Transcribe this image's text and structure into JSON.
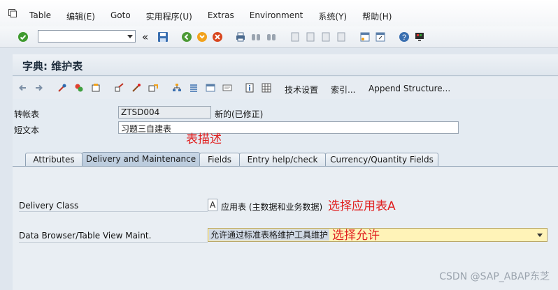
{
  "menu": [
    "Table",
    "编辑(E)",
    "Goto",
    "实用程序(U)",
    "Extras",
    "Environment",
    "系统(Y)",
    "帮助(H)"
  ],
  "title": "字典: 维护表",
  "app_toolbar": {
    "tech_settings": "技术设置",
    "indexes": "索引...",
    "append_structure": "Append Structure..."
  },
  "fields": {
    "table_label": "转帐表",
    "table_value": "ZTSD004",
    "status": "新的(已修正)",
    "short_text_label": "短文本",
    "short_text_value": "习题三自建表"
  },
  "annotations": {
    "table_desc": "表描述",
    "select_app_table": "选择应用表A",
    "select_allow": "选择允许"
  },
  "tabs": [
    "Attributes",
    "Delivery and Maintenance",
    "Fields",
    "Entry help/check",
    "Currency/Quantity Fields"
  ],
  "active_tab": "Delivery and Maintenance",
  "delivery": {
    "class_label": "Delivery Class",
    "class_value": "A",
    "class_desc": "应用表 (主数据和业务数据)",
    "browser_label": "Data Browser/Table View Maint.",
    "browser_value": "允许通过标准表格维护工具维护"
  },
  "watermark": "CSDN @SAP_ABAP东芝",
  "colors": {
    "highlight_field": "#fff3b8",
    "annotation": "#e02020"
  }
}
